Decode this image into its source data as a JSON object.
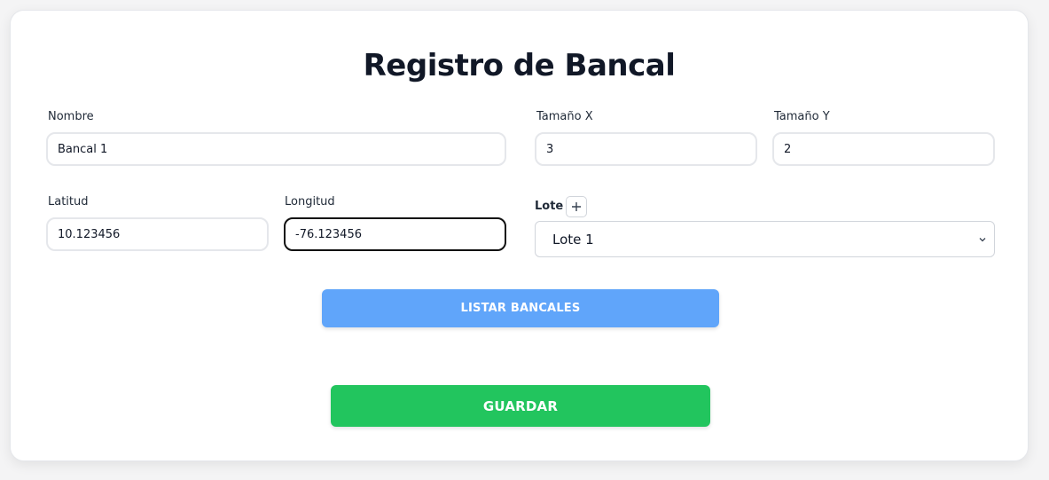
{
  "form": {
    "title": "Registro de Bancal",
    "nombre": {
      "label": "Nombre",
      "value": "Bancal 1"
    },
    "tamano_x": {
      "label": "Tamaño X",
      "value": "3"
    },
    "tamano_y": {
      "label": "Tamaño Y",
      "value": "2"
    },
    "latitud": {
      "label": "Latitud",
      "value": "10.123456"
    },
    "longitud": {
      "label": "Longitud",
      "value": "-76.123456"
    },
    "lote": {
      "label": "Lote",
      "selected": "Lote 1",
      "add_icon": "plus-icon"
    }
  },
  "buttons": {
    "listar": "LISTAR BANCALES",
    "guardar": "GUARDAR"
  },
  "colors": {
    "listar_bg": "#60a5fa",
    "guardar_bg": "#22c55e",
    "focus_border": "#111111"
  }
}
